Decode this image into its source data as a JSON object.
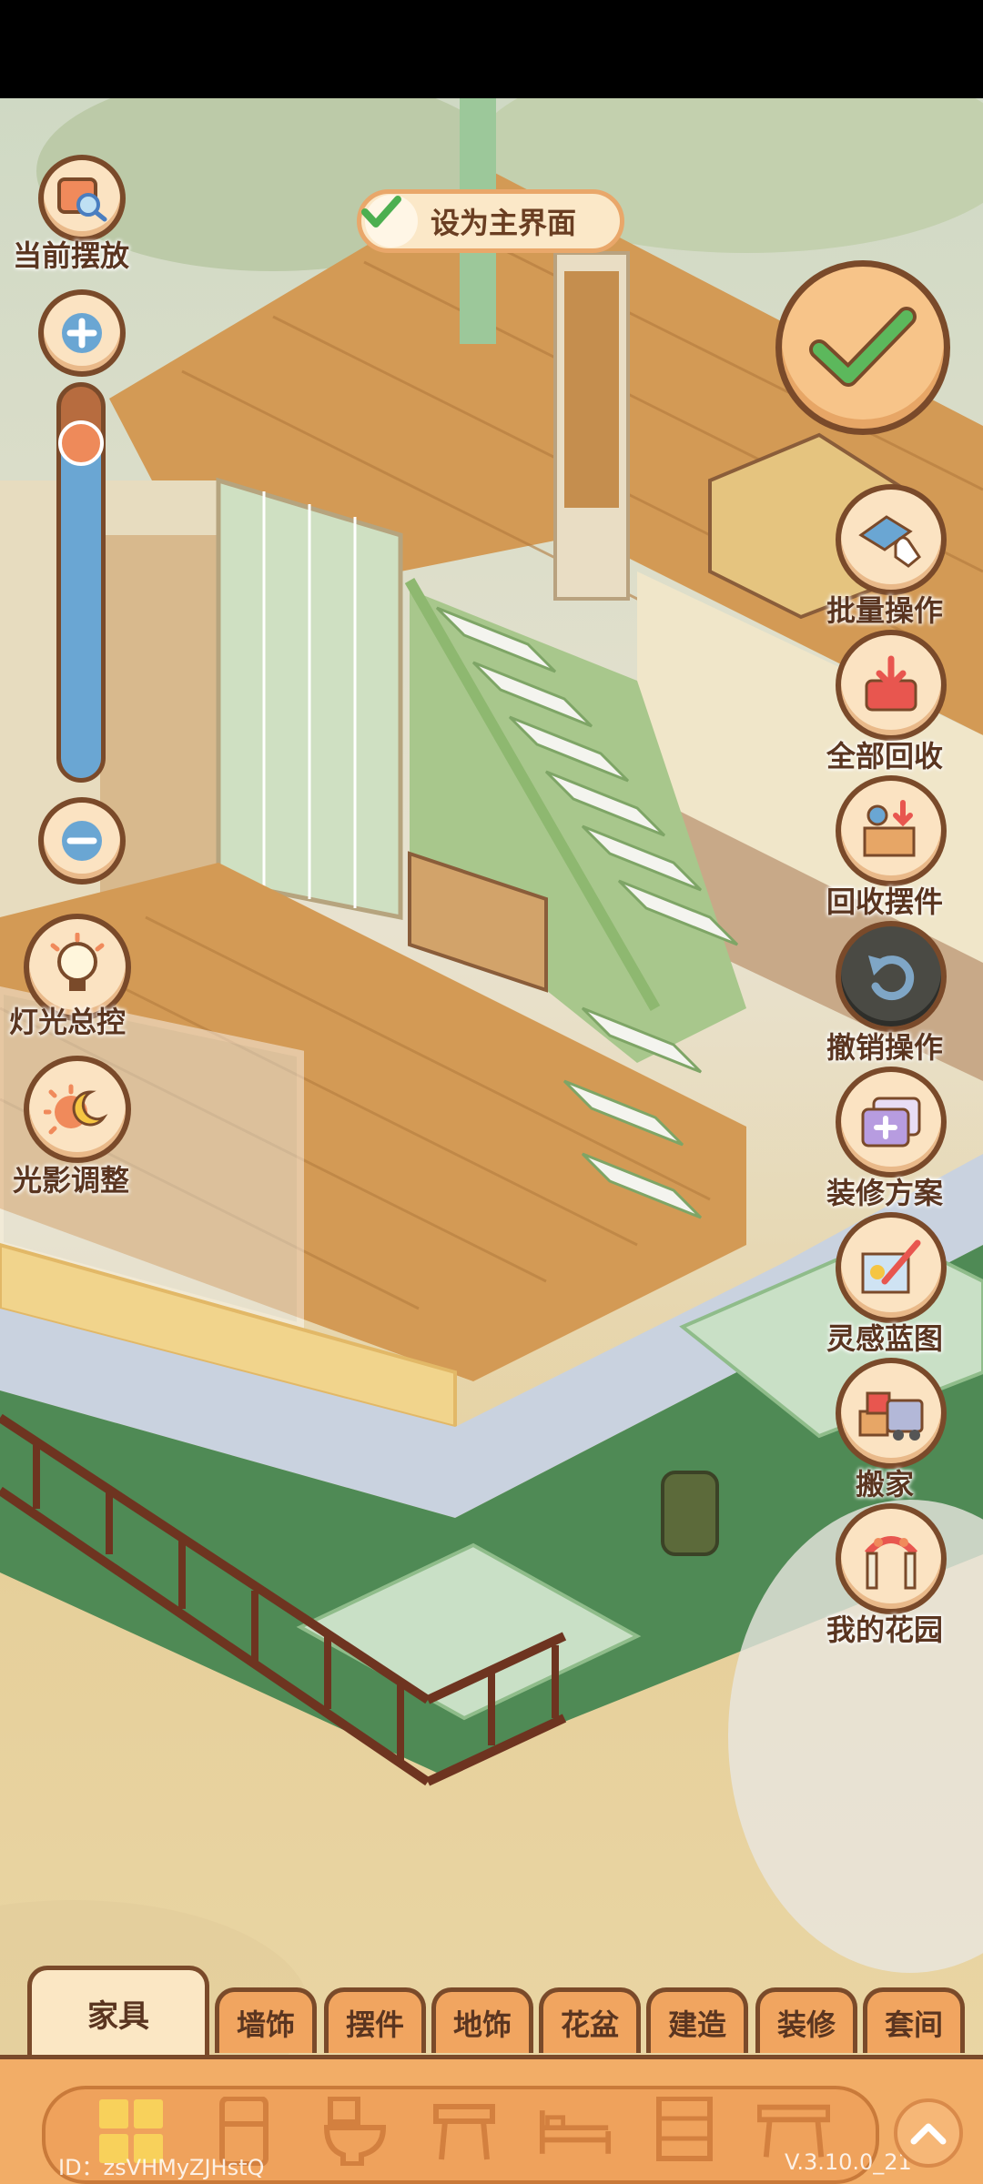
{
  "home_button": {
    "label": "设为主界面"
  },
  "left_controls": {
    "current_placement": "当前摆放",
    "zoom_level": 0.33,
    "light_control": "灯光总控",
    "shadow_adjust": "光影调整"
  },
  "right_controls": [
    {
      "label": "批量操作",
      "icon": "batch-hand-icon"
    },
    {
      "label": "全部回收",
      "icon": "recycle-all-icon"
    },
    {
      "label": "回收摆件",
      "icon": "recycle-decor-icon"
    },
    {
      "label": "撤销操作",
      "icon": "undo-icon"
    },
    {
      "label": "装修方案",
      "icon": "renovation-plan-icon"
    },
    {
      "label": "灵感蓝图",
      "icon": "blueprint-icon"
    },
    {
      "label": "搬家",
      "icon": "moving-truck-icon"
    },
    {
      "label": "我的花园",
      "icon": "garden-gate-icon"
    }
  ],
  "tabs": [
    "家具",
    "墙饰",
    "摆件",
    "地饰",
    "花盆",
    "建造",
    "装修",
    "套间"
  ],
  "active_tab": "家具",
  "footer": {
    "id_text": "ID：zsVHMyZJHstQ",
    "version": "V.3.10.0_21"
  },
  "colors": {
    "accent": "#7a4a2a",
    "panel": "#f2ad67",
    "check": "#5cb85c"
  }
}
